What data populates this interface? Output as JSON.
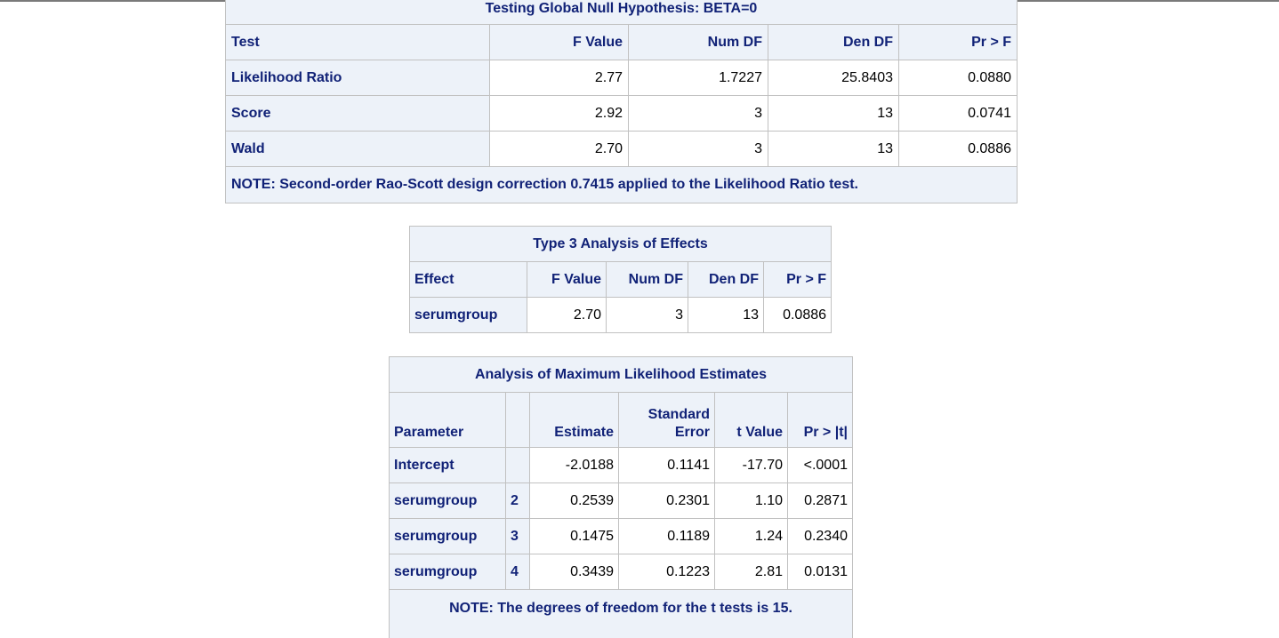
{
  "global_null": {
    "title": "Testing Global Null Hypothesis: BETA=0",
    "headers": [
      "Test",
      "F Value",
      "Num DF",
      "Den DF",
      "Pr > F"
    ],
    "rows": [
      [
        "Likelihood Ratio",
        "2.77",
        "1.7227",
        "25.8403",
        "0.0880"
      ],
      [
        "Score",
        "2.92",
        "3",
        "13",
        "0.0741"
      ],
      [
        "Wald",
        "2.70",
        "3",
        "13",
        "0.0886"
      ]
    ],
    "note": "NOTE: Second-order Rao-Scott design correction 0.7415 applied to the Likelihood Ratio test."
  },
  "type3": {
    "title": "Type 3 Analysis of Effects",
    "headers": [
      "Effect",
      "F Value",
      "Num DF",
      "Den DF",
      "Pr > F"
    ],
    "rows": [
      [
        "serumgroup",
        "2.70",
        "3",
        "13",
        "0.0886"
      ]
    ]
  },
  "mle": {
    "title": "Analysis of Maximum Likelihood Estimates",
    "headers": {
      "parameter": "Parameter",
      "level": "",
      "estimate": "Estimate",
      "stderr_line1": "Standard",
      "stderr_line2": "Error",
      "tvalue": "t Value",
      "pr": "Pr > |t|"
    },
    "rows": [
      [
        "Intercept",
        "",
        "-2.0188",
        "0.1141",
        "-17.70",
        "<.0001"
      ],
      [
        "serumgroup",
        "2",
        "0.2539",
        "0.2301",
        "1.10",
        "0.2871"
      ],
      [
        "serumgroup",
        "3",
        "0.1475",
        "0.1189",
        "1.24",
        "0.2340"
      ],
      [
        "serumgroup",
        "4",
        "0.3439",
        "0.1223",
        "2.81",
        "0.0131"
      ]
    ],
    "note": "NOTE: The degrees of freedom for the t tests is 15."
  }
}
